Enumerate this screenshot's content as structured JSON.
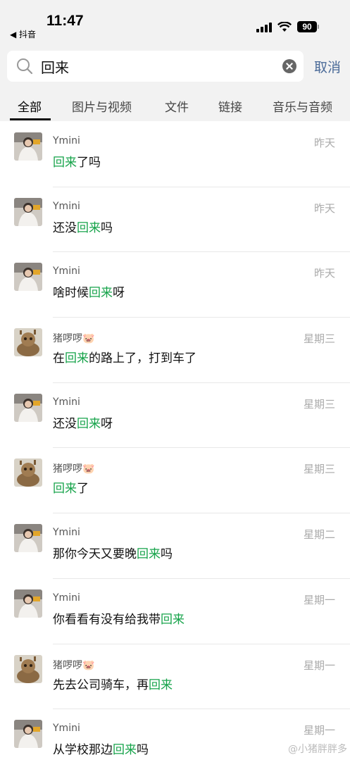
{
  "status": {
    "time": "11:47",
    "back_label": "◀ 抖音",
    "battery": "90"
  },
  "search": {
    "query": "回来",
    "cancel_label": "取消"
  },
  "tabs": [
    {
      "label": "全部",
      "active": true
    },
    {
      "label": "图片与视频",
      "active": false
    },
    {
      "label": "文件",
      "active": false
    },
    {
      "label": "链接",
      "active": false
    },
    {
      "label": "音乐与音频",
      "active": false
    }
  ],
  "results": [
    {
      "sender": "Ymini",
      "date": "昨天",
      "avatar": "girl",
      "pre": "",
      "hl": "回来",
      "post": "了吗"
    },
    {
      "sender": "Ymini",
      "date": "昨天",
      "avatar": "girl",
      "pre": "还没",
      "hl": "回来",
      "post": "吗"
    },
    {
      "sender": "Ymini",
      "date": "昨天",
      "avatar": "girl",
      "pre": "啥时候",
      "hl": "回来",
      "post": "呀"
    },
    {
      "sender": "猪啰啰🐷",
      "date": "星期三",
      "avatar": "groot",
      "pre": "在",
      "hl": "回来",
      "post": "的路上了，打到车了"
    },
    {
      "sender": "Ymini",
      "date": "星期三",
      "avatar": "girl",
      "pre": "还没",
      "hl": "回来",
      "post": "呀"
    },
    {
      "sender": "猪啰啰🐷",
      "date": "星期三",
      "avatar": "groot",
      "pre": "",
      "hl": "回来",
      "post": "了"
    },
    {
      "sender": "Ymini",
      "date": "星期二",
      "avatar": "girl",
      "pre": "那你今天又要晚",
      "hl": "回来",
      "post": "吗"
    },
    {
      "sender": "Ymini",
      "date": "星期一",
      "avatar": "girl",
      "pre": "你看看有没有给我带",
      "hl": "回来",
      "post": ""
    },
    {
      "sender": "猪啰啰🐷",
      "date": "星期一",
      "avatar": "groot",
      "pre": "先去公司骑车，再",
      "hl": "回来",
      "post": ""
    },
    {
      "sender": "Ymini",
      "date": "星期一",
      "avatar": "girl",
      "pre": "从学校那边",
      "hl": "回来",
      "post": "吗"
    }
  ],
  "watermark": "@小猪胖胖多",
  "colors": {
    "highlight": "#16a34a",
    "cancel": "#4a6a98",
    "header_bg": "#f2f2f2"
  }
}
